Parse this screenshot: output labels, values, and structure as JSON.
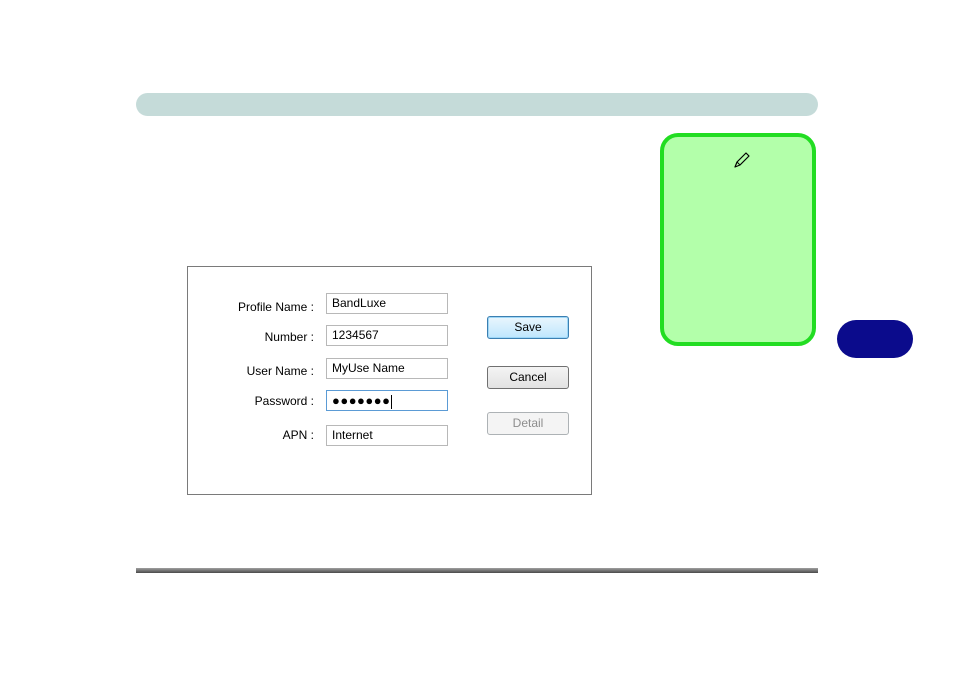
{
  "dialog": {
    "fields": {
      "profile_name": {
        "label": "Profile Name :",
        "value": "BandLuxe"
      },
      "number": {
        "label": "Number :",
        "value": "1234567"
      },
      "user_name": {
        "label": "User Name :",
        "value": "MyUse Name"
      },
      "password": {
        "label": "Password :",
        "value": "●●●●●●●"
      },
      "apn": {
        "label": "APN :",
        "value": "Internet"
      }
    },
    "buttons": {
      "save": "Save",
      "cancel": "Cancel",
      "detail": "Detail"
    }
  },
  "note": {
    "icon": "pencil-icon"
  },
  "colors": {
    "header_bar": "#c5dbd9",
    "note_background": "#b3ffaa",
    "note_border": "#22dd22",
    "chapter_tab": "#0b0b8c"
  }
}
